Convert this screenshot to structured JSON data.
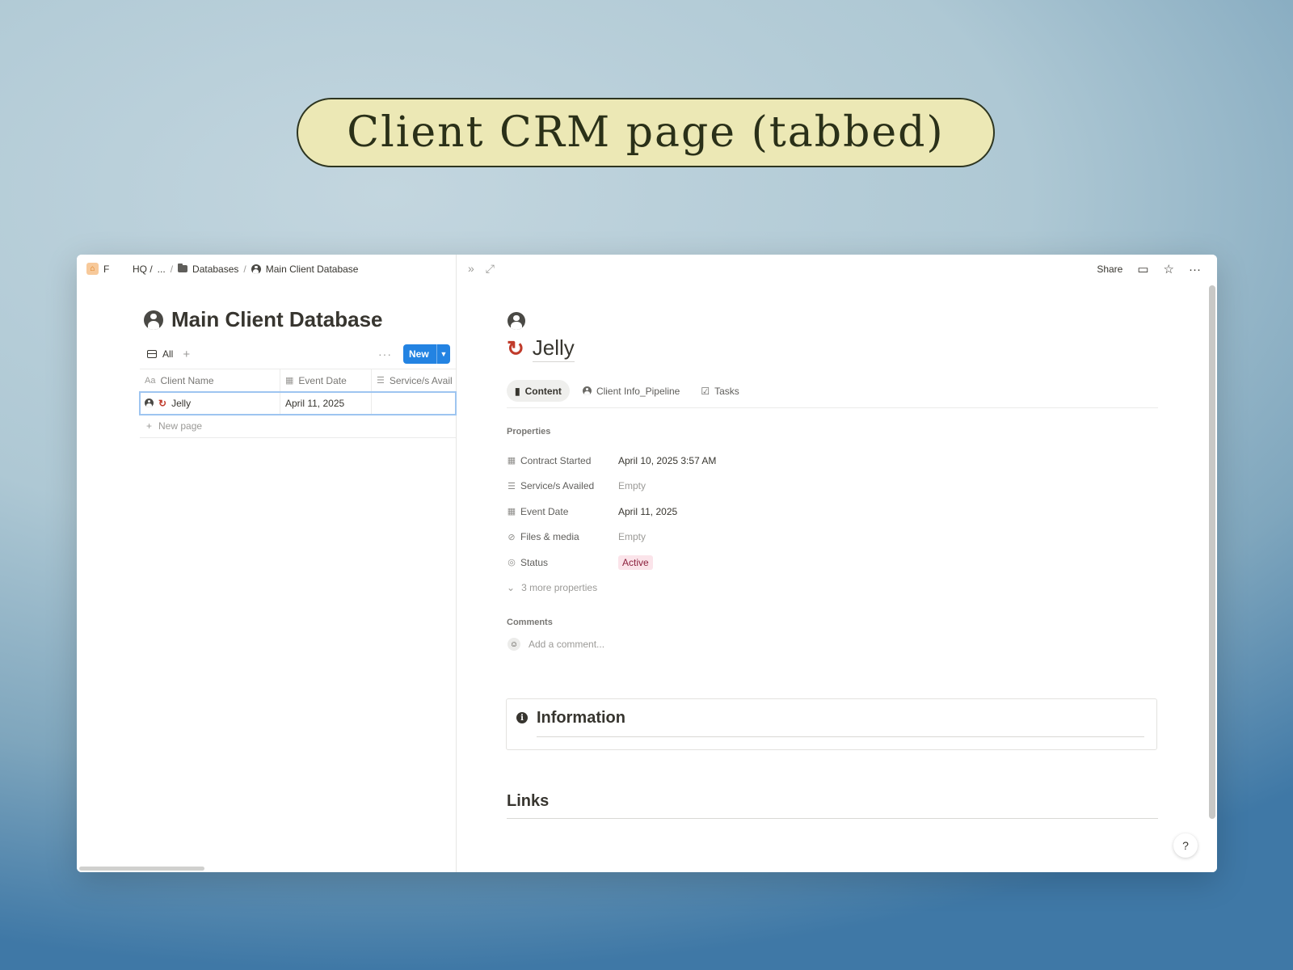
{
  "banner": {
    "title": "Client CRM page (tabbed)"
  },
  "left": {
    "breadcrumb": [
      "F",
      "HQ /",
      "...",
      "/",
      "Databases",
      "/",
      "Main Client Database"
    ],
    "db_title": "Main Client Database",
    "view_tab": "All",
    "new_button": "New",
    "columns": [
      "Client Name",
      "Event Date",
      "Service/s Avail"
    ],
    "column_icons": [
      "Aa",
      "calendar-icon",
      "list-icon"
    ],
    "rows": [
      {
        "name": "Jelly",
        "event_date": "April 11, 2025",
        "services": ""
      }
    ],
    "new_page": "New page"
  },
  "right": {
    "topbar": {
      "share": "Share"
    },
    "page_title": "Jelly",
    "tabs": [
      "Content",
      "Client Info_Pipeline",
      "Tasks"
    ],
    "properties_label": "Properties",
    "properties": [
      {
        "icon": "calendar-icon",
        "key": "Contract Started",
        "value": "April 10, 2025 3:57 AM",
        "empty": false
      },
      {
        "icon": "list-icon",
        "key": "Service/s Availed",
        "value": "Empty",
        "empty": true
      },
      {
        "icon": "calendar-icon",
        "key": "Event Date",
        "value": "April 11, 2025",
        "empty": false
      },
      {
        "icon": "paperclip-icon",
        "key": "Files & media",
        "value": "Empty",
        "empty": true
      },
      {
        "icon": "status-icon",
        "key": "Status",
        "value": "Active",
        "badge": true
      }
    ],
    "more_properties": "3 more properties",
    "comments_label": "Comments",
    "comment_placeholder": "Add a comment...",
    "info_heading": "Information",
    "links_heading": "Links"
  },
  "colors": {
    "accent_blue": "#2383e2",
    "status_badge_bg": "#fbe4ea",
    "loop_icon_red": "#c03b2b"
  }
}
